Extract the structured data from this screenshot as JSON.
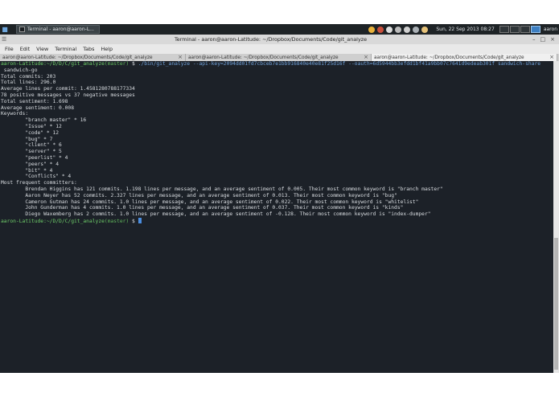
{
  "panel": {
    "menu_icon": "app-menu-icon",
    "task_label": "Terminal - aaron@aaron-L...",
    "clock": "Sun, 22 Sep 2013 08:27",
    "user": "aaron"
  },
  "window": {
    "title": "Terminal - aaron@aaron-Latitude: ~/Dropbox/Documents/Code/git_analyze",
    "buttons": [
      "–",
      "□",
      "×"
    ]
  },
  "menubar": [
    "File",
    "Edit",
    "View",
    "Terminal",
    "Tabs",
    "Help"
  ],
  "tabs": [
    {
      "label": "aaron@aaron-Latitude: ~/Dropbox/Documents/Code/git_analyze",
      "active": false
    },
    {
      "label": "aaron@aaron-Latitude: ~/Dropbox/Documents/Code/git_analyze",
      "active": false
    },
    {
      "label": "aaron@aaron-Latitude: ~/Dropbox/Documents/Code/git_analyze",
      "active": true
    }
  ],
  "terminal": {
    "prompt": {
      "user": "aaron-Latitude:~/D/D/C/git_analyze",
      "branch": "(master)",
      "symbol": " $ "
    },
    "command": "./bin/git_analyze --api-key=2094dd01fd7cbceb7e1bb916840e40e81f25d16f --oauth=6d5944bb3efdd1bf41a9bb07c7641d9edeab301f sandwich-share",
    "command_wrap": " sandwich-go",
    "output": [
      "Total commits: 203",
      "Total lines: 296.0",
      "Average lines per commit: 1.4581280788177334",
      "78 positive messages vs 37 negative messages",
      "Total sentiment: 1.698",
      "Average sentiment: 0.008",
      "Keywords:",
      "        \"branch master\" * 16",
      "        \"Issue\" * 12",
      "        \"code\" * 12",
      "        \"bug\" * 7",
      "        \"client\" * 6",
      "        \"server\" * 5",
      "        \"peerlist\" * 4",
      "        \"peers\" * 4",
      "        \"bit\" * 4",
      "        \"Conflicts\" * 4",
      "Most frequent committers:",
      "        Brendan Higgins has 121 commits. 1.198 lines per message, and an average sentiment of 0.005. Their most common keyword is \"branch master\"",
      "        Aaron Neyer has 52 commits. 2.327 lines per message, and an average sentiment of 0.013. Their most common keyword is \"bug\"",
      "        Cameron Gutman has 24 commits. 1.0 lines per message, and an average sentiment of 0.022. Their most common keyword is \"whitelist\"",
      "        John Gunderman has 4 commits. 1.0 lines per message, and an average sentiment of 0.037. Their most common keyword is \"kinds\"",
      "        Diego Waxemberg has 2 commits. 1.0 lines per message, and an average sentiment of -0.128. Their most common keyword is \"index-dumper\""
    ]
  },
  "colors": {
    "terminal_bg": "#1c2128",
    "prompt_user": "#6fcf6a",
    "command": "#6fa0d8"
  }
}
